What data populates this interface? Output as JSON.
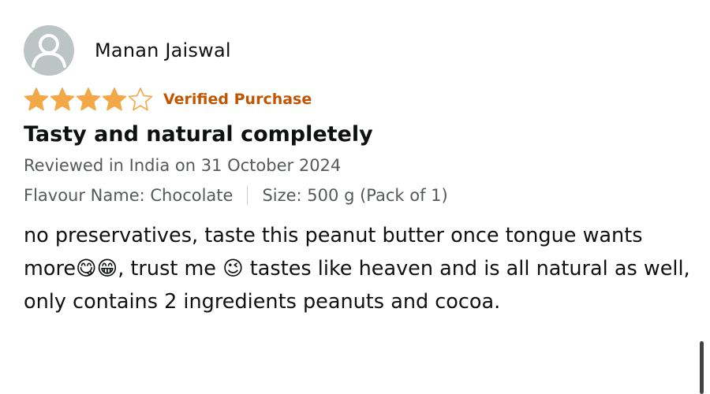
{
  "review": {
    "reviewer_name": "Manan Jaiswal",
    "avatar_icon": "default-user-avatar-icon",
    "rating": 4,
    "rating_max": 5,
    "star_color": "#f3a847",
    "verified_label": "Verified Purchase",
    "verified_color": "#c45500",
    "title": "Tasty and natural completely",
    "meta": "Reviewed in India on 31 October 2024",
    "flavour": "Flavour Name: Chocolate",
    "size": "Size: 500 g (Pack of 1)",
    "body": "no preservatives, taste this peanut butter once tongue wants more😋😁, trust me 😉 tastes like heaven and is all natural as well, only contains 2 ingredients peanuts and cocoa."
  }
}
